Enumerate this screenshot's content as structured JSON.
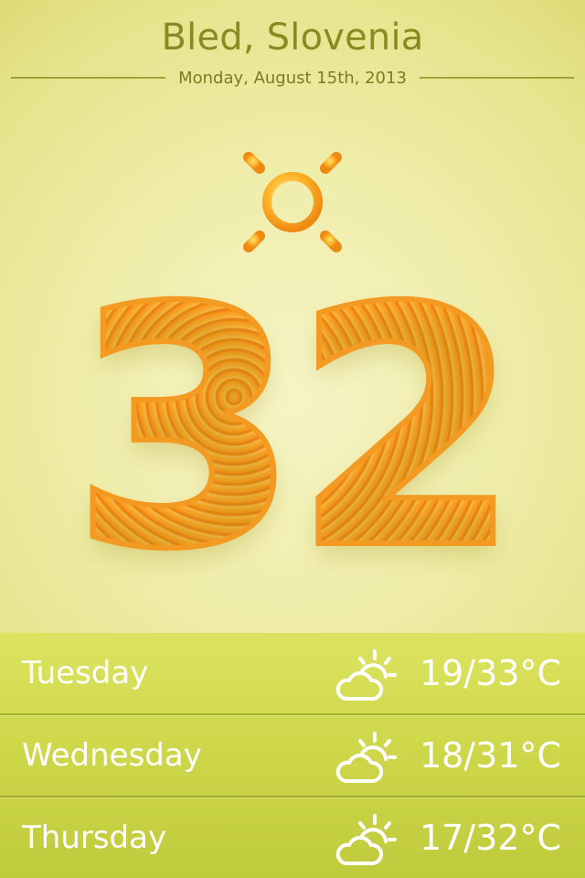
{
  "location": {
    "city": "Bled, Slovenia",
    "date": "Monday, August 15th, 2013"
  },
  "current": {
    "temperature": "32",
    "icon": "sun-icon"
  },
  "forecast": [
    {
      "day": "Tuesday",
      "icon": "partly-cloudy-icon",
      "range": "19/33°C"
    },
    {
      "day": "Wednesday",
      "icon": "partly-cloudy-icon",
      "range": "18/31°C"
    },
    {
      "day": "Thursday",
      "icon": "partly-cloudy-icon",
      "range": "17/32°C"
    }
  ],
  "colors": {
    "background": "#efeda9",
    "title": "#8b8a22",
    "amber": "#f39a22",
    "forecast_band": "#cfd84b"
  }
}
